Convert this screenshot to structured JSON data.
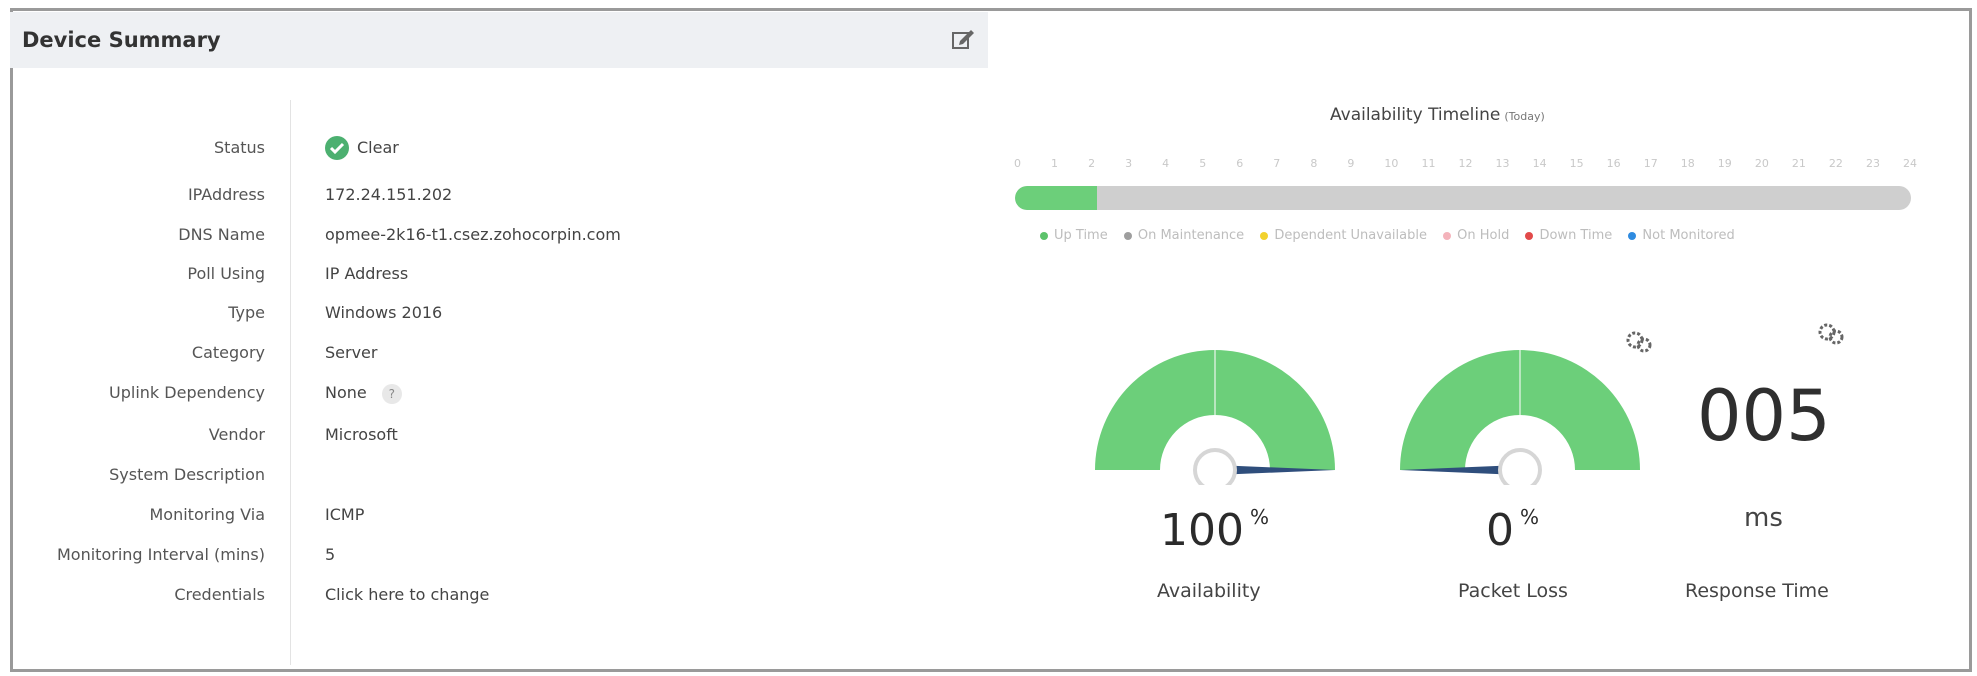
{
  "header": {
    "title": "Device Summary",
    "edit_icon": "edit-icon"
  },
  "details": [
    {
      "label": "Status",
      "value": "Clear",
      "name": "status"
    },
    {
      "label": "IPAddress",
      "value": "172.24.151.202",
      "name": "ip-address"
    },
    {
      "label": "DNS Name",
      "value": "opmee-2k16-t1.csez.zohocorpin.com",
      "name": "dns-name"
    },
    {
      "label": "Poll Using",
      "value": "IP Address",
      "name": "poll-using"
    },
    {
      "label": "Type",
      "value": "Windows 2016",
      "name": "type"
    },
    {
      "label": "Category",
      "value": "Server",
      "name": "category"
    },
    {
      "label": "Uplink Dependency",
      "value": "None",
      "help": "?",
      "name": "uplink-dependency"
    },
    {
      "label": "Vendor",
      "value": "Microsoft",
      "name": "vendor"
    },
    {
      "label": "System Description",
      "value": "",
      "name": "system-description"
    },
    {
      "label": "Monitoring Via",
      "value": "ICMP",
      "name": "monitoring-via"
    },
    {
      "label": "Monitoring Interval (mins)",
      "value": "5",
      "name": "monitoring-interval"
    },
    {
      "label": "Credentials",
      "value": "Click here to change",
      "name": "credentials"
    }
  ],
  "timeline": {
    "title": "Availability Timeline",
    "subtitle": "(Today)",
    "hours": [
      "0",
      "1",
      "2",
      "3",
      "4",
      "5",
      "6",
      "7",
      "8",
      "9",
      "10",
      "11",
      "12",
      "13",
      "14",
      "15",
      "16",
      "17",
      "18",
      "19",
      "20",
      "21",
      "22",
      "23",
      "24"
    ],
    "uptime_until_hour": 2.2,
    "legend": [
      {
        "label": "Up Time",
        "color": "#5cc36b"
      },
      {
        "label": "On Maintenance",
        "color": "#9e9e9e"
      },
      {
        "label": "Dependent Unavailable",
        "color": "#f2d22e"
      },
      {
        "label": "On Hold",
        "color": "#f4b3bb"
      },
      {
        "label": "Down Time",
        "color": "#e24a4a"
      },
      {
        "label": "Not Monitored",
        "color": "#2f8be0"
      }
    ]
  },
  "gauges": {
    "availability": {
      "value": "100",
      "unit": "%",
      "label": "Availability",
      "percent": 100
    },
    "packet_loss": {
      "value": "0",
      "unit": "%",
      "label": "Packet Loss",
      "percent": 0
    },
    "response_time": {
      "value": "005",
      "unit": "ms",
      "label": "Response Time"
    }
  },
  "icons": {
    "settings": "settings-icon",
    "status": "check-circle-icon",
    "edit": "edit-icon"
  }
}
